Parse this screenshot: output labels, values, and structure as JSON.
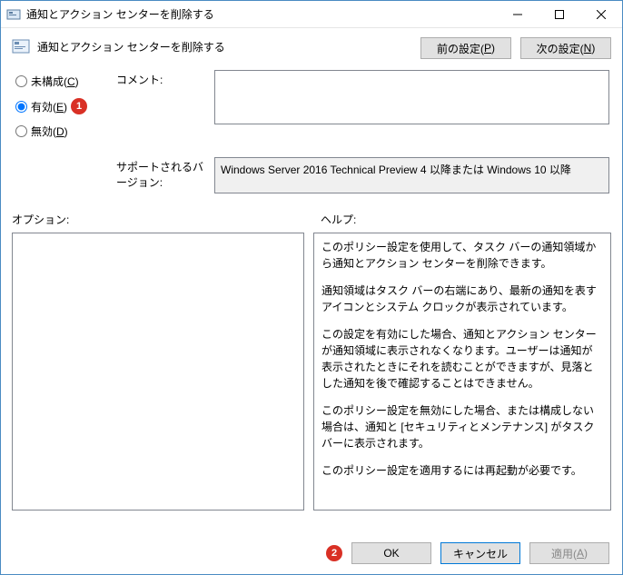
{
  "titlebar": {
    "text": "通知とアクション センターを削除する"
  },
  "header": {
    "title": "通知とアクション センターを削除する",
    "prev_button": "前の設定(P)",
    "prev_button_pre": "前の設定(",
    "prev_button_key": "P",
    "prev_button_post": ")",
    "next_button_pre": "次の設定(",
    "next_button_key": "N",
    "next_button_post": ")"
  },
  "radios": {
    "not_configured_pre": "未構成(",
    "not_configured_key": "C",
    "not_configured_post": ")",
    "enabled_pre": "有効(",
    "enabled_key": "E",
    "enabled_post": ")",
    "disabled_pre": "無効(",
    "disabled_key": "D",
    "disabled_post": ")",
    "selected": "enabled"
  },
  "labels": {
    "comment": "コメント:",
    "supported": "サポートされるバージョン:",
    "options": "オプション:",
    "help": "ヘルプ:"
  },
  "fields": {
    "comment_value": "",
    "supported_value": "Windows Server 2016 Technical Preview 4 以降または Windows 10 以降"
  },
  "help_text": {
    "p1": "このポリシー設定を使用して、タスク バーの通知領域から通知とアクション センターを削除できます。",
    "p2": "通知領域はタスク バーの右端にあり、最新の通知を表すアイコンとシステム クロックが表示されています。",
    "p3": "この設定を有効にした場合、通知とアクション センターが通知領域に表示されなくなります。ユーザーは通知が表示されたときにそれを読むことができますが、見落とした通知を後で確認することはできません。",
    "p4": "このポリシー設定を無効にした場合、または構成しない場合は、通知と [セキュリティとメンテナンス] がタスク バーに表示されます。",
    "p5": "このポリシー設定を適用するには再起動が必要です。"
  },
  "footer": {
    "ok": "OK",
    "cancel": "キャンセル",
    "apply_pre": "適用(",
    "apply_key": "A",
    "apply_post": ")"
  },
  "annotations": {
    "one": "1",
    "two": "2"
  }
}
